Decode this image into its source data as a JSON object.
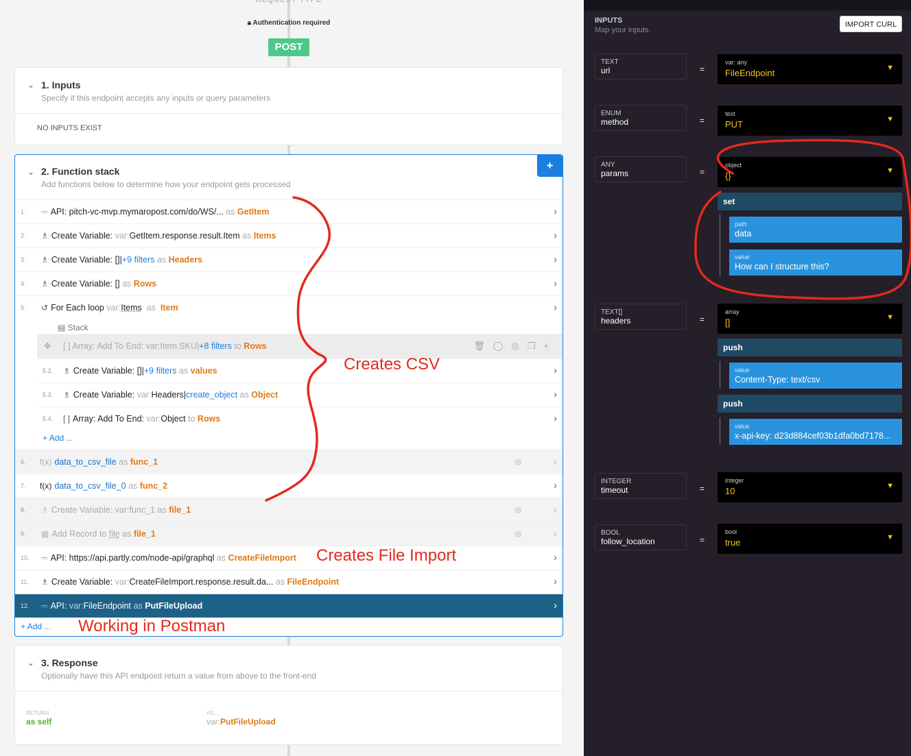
{
  "header": {
    "request_type": "REQUEST TYPE",
    "auth": "Authentication required",
    "method": "POST"
  },
  "inputs_section": {
    "title": "1. Inputs",
    "subtitle": "Specify if this endpoint accepts any inputs or query parameters",
    "empty": "NO INPUTS EXIST"
  },
  "stack_section": {
    "title": "2. Function stack",
    "subtitle": "Add functions below to determine how your endpoint gets processed",
    "add_icon": "+"
  },
  "rows": {
    "r1": {
      "num": "1.",
      "text": "API: pitch-vc-mvp.mymaropost.com/do/WS/...",
      "as": "as",
      "name": "GetItem"
    },
    "r2": {
      "num": "2.",
      "label": "Create Variable:",
      "var": "var:",
      "expr": "GetItem.response.result.Item",
      "as": "as",
      "name": "Items"
    },
    "r3": {
      "num": "3.",
      "label": "Create Variable:",
      "expr": "[]|",
      "filters": "+9 filters",
      "as": "as",
      "name": "Headers"
    },
    "r4": {
      "num": "4.",
      "label": "Create Variable:",
      "expr": "[]",
      "as": "as",
      "name": "Rows"
    },
    "r5": {
      "num": "5.",
      "label": "For Each loop",
      "var": "var:",
      "expr": "Items",
      "as": "as",
      "name": "Item",
      "stack": "Stack"
    },
    "r51": {
      "text": "[ ] Array: Add To End: var:Item.SKU|",
      "filters": "+8 filters",
      "to": "to",
      "name": "Rows"
    },
    "r52": {
      "num": "5.2.",
      "label": "Create Variable:",
      "expr": "[]|",
      "filters": "+9 filters",
      "as": "as",
      "name": "values"
    },
    "r53": {
      "num": "5.3.",
      "label": "Create Variable:",
      "var": "var:",
      "expr": "Headers|",
      "fn": "create_object",
      "as": "as",
      "name": "Object"
    },
    "r54": {
      "num": "5.4.",
      "label": "Array: Add To End:",
      "var": "var:",
      "expr": "Object",
      "to": "to",
      "name": "Rows"
    },
    "add_inner": "Add ...",
    "r6": {
      "num": "6.",
      "fn": "data_to_csv_file",
      "as": "as",
      "name": "func_1"
    },
    "r7": {
      "num": "7.",
      "fn": "data_to_csv_file_0",
      "as": "as",
      "name": "func_2"
    },
    "r8": {
      "num": "8.",
      "text": "Create Variable: var:func_1",
      "as": "as",
      "name": "file_1"
    },
    "r9": {
      "num": "9.",
      "text": "Add Record to",
      "file": "file",
      "as": "as",
      "name": "file_1"
    },
    "r10": {
      "num": "10.",
      "text": "API: https://api.partly.com/node-api/graphql",
      "as": "as",
      "name": "CreateFileImport"
    },
    "r11": {
      "num": "11.",
      "label": "Create Variable:",
      "var": "var:",
      "expr": "CreateFileImport.response.result.da...",
      "as": "as",
      "name": "FileEndpoint"
    },
    "r12": {
      "num": "12.",
      "label": "API:",
      "var": "var:",
      "expr": "FileEndpoint",
      "as": "as",
      "name": "PutFileUpload"
    },
    "add_outer": "Add ..."
  },
  "response_section": {
    "title": "3. Response",
    "subtitle": "Optionally have this API endpoint return a value from above to the front-end",
    "return_label": "RETURN",
    "return_value": "as self",
    "as_label": "AS...",
    "as_var": "var:",
    "as_value": "PutFileUpload"
  },
  "annotations": {
    "csv": "Creates CSV",
    "file_import": "Creates File Import",
    "postman": "Working in Postman"
  },
  "panel": {
    "title": "INPUTS",
    "subtitle": "Map your inputs.",
    "import_curl": "IMPORT CURL",
    "eq": "=",
    "url": {
      "type": "TEXT",
      "name": "url",
      "vtype": "var: any",
      "value": "FileEndpoint"
    },
    "method": {
      "type": "ENUM",
      "name": "method",
      "vtype": "text",
      "value": "PUT"
    },
    "params": {
      "type": "ANY",
      "name": "params",
      "vtype": "object",
      "value": "{}",
      "op": "set",
      "path_label": "path",
      "path_value": "data",
      "value_label": "value",
      "value_value": "How can I structure this?"
    },
    "headers": {
      "type": "TEXT[]",
      "name": "headers",
      "vtype": "array",
      "value": "[]",
      "op1": "push",
      "v1_label": "value",
      "v1": "Content-Type: text/csv",
      "op2": "push",
      "v2_label": "value",
      "v2": "x-api-key: d23d884cef03b1dfa0bd7178..."
    },
    "timeout": {
      "type": "INTEGER",
      "name": "timeout",
      "vtype": "integer",
      "value": "10"
    },
    "follow": {
      "type": "BOOL",
      "name": "follow_location",
      "vtype": "bool",
      "value": "true"
    }
  },
  "colors": {
    "accent": "#1a7fe0",
    "post": "#4cc98a",
    "orange": "#e07b16",
    "annotation": "#e22a1c",
    "panel": "#241f29"
  }
}
